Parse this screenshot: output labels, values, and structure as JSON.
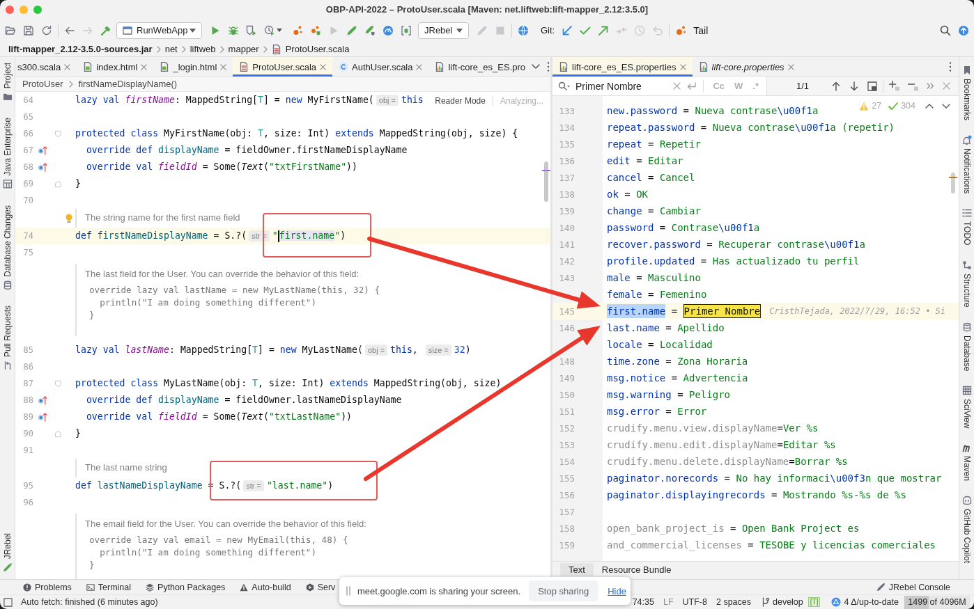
{
  "window": {
    "title": "OBP-API-2022 – ProtoUser.scala [Maven: net.liftweb:lift-mapper_2.12:3.5.0]"
  },
  "toolbar": {
    "buttons": [
      {
        "disabled": false
      },
      {
        "disabled": false
      },
      {
        "disabled": false
      },
      {
        "disabled": false
      },
      {
        "disabled": true
      },
      {
        "disabled": false
      },
      {
        "disabled": false
      },
      {
        "disabled": false
      },
      {
        "disabled": false
      },
      {
        "disabled": false
      },
      {
        "disabled": false
      },
      {
        "disabled": false
      },
      {
        "disabled": true
      },
      {
        "disabled": false
      },
      {
        "disabled": false
      },
      {
        "disabled": false
      },
      {
        "disabled": false
      },
      {
        "disabled": true
      },
      {
        "disabled": true
      },
      {
        "disabled": false
      },
      {
        "disabled": false
      },
      {
        "disabled": false
      },
      {
        "disabled": false
      },
      {
        "disabled": true
      },
      {
        "disabled": true
      },
      {
        "disabled": true
      },
      {
        "disabled": false
      },
      {
        "disabled": false
      },
      {
        "disabled": false
      }
    ],
    "run_configuration": "RunWebApp",
    "jrebel_menu": "JRebel",
    "git_label": "Git:",
    "tail_button": "Tail"
  },
  "navigation_bar": {
    "items": [
      "lift-mapper_2.12-3.5.0-sources.jar",
      "net",
      "liftweb",
      "mapper",
      "ProtoUser.scala"
    ]
  },
  "left_tool_strip": {
    "top": [
      {
        "label": "Project"
      },
      {
        "label": "Java Enterprise"
      },
      {
        "label": "Database Changes"
      },
      {
        "label": "Pull Requests"
      }
    ],
    "bottom": [
      {
        "label": "JRebel"
      }
    ]
  },
  "left_editor": {
    "tabs": [
      {
        "label": "s300.scala",
        "kind": "plain",
        "selected": false,
        "closable": true
      },
      {
        "label": "index.html",
        "kind": "html",
        "selected": false,
        "closable": true
      },
      {
        "label": "_login.html",
        "kind": "html",
        "selected": false,
        "closable": true
      },
      {
        "label": "ProtoUser.scala",
        "kind": "scala",
        "selected": true,
        "closable": true
      },
      {
        "label": "AuthUser.scala",
        "kind": "class",
        "selected": false,
        "closable": true
      },
      {
        "label": "lift-core_es_ES.pro",
        "kind": "properties",
        "selected": false,
        "closable": false
      }
    ],
    "breadcrumbs": [
      "ProtoUser",
      "firstNameDisplayName()"
    ],
    "reader_mode": "Reader Mode",
    "analysis_status": "Analyzing...",
    "lines": [
      {
        "kind": "code",
        "number": "64",
        "current": false,
        "tokens": [
          {
            "kind": "kw",
            "text": "lazy val "
          },
          {
            "kind": "field",
            "text": "firstName"
          },
          {
            "kind": "plain",
            "text": ": MappedString["
          },
          {
            "kind": "tparam",
            "text": "T"
          },
          {
            "kind": "plain",
            "text": "] = "
          },
          {
            "kind": "kw",
            "text": "new "
          },
          {
            "kind": "plain",
            "text": "MyFirstName("
          },
          {
            "kind": "hint",
            "text": "obj ="
          },
          {
            "kind": "kw",
            "text": "this"
          }
        ]
      },
      {
        "kind": "code",
        "number": "65",
        "current": false
      },
      {
        "kind": "code",
        "number": "66",
        "marker": {
          "kind": "fold-start"
        },
        "current": false,
        "tokens": [
          {
            "kind": "kw",
            "text": "protected class "
          },
          {
            "kind": "plain",
            "text": "MyFirstName(obj: "
          },
          {
            "kind": "tparam",
            "text": "T"
          },
          {
            "kind": "plain",
            "text": ", size: Int) "
          },
          {
            "kind": "kw",
            "text": "extends "
          },
          {
            "kind": "plain",
            "text": "MappedString(obj, size) {"
          }
        ]
      },
      {
        "kind": "code",
        "number": "67",
        "marker": {
          "kind": "override"
        },
        "current": false,
        "tokens": [
          {
            "kind": "kw",
            "text": "  override def "
          },
          {
            "kind": "decl",
            "text": "displayName"
          },
          {
            "kind": "plain",
            "text": " = fieldOwner.firstNameDisplayName"
          }
        ]
      },
      {
        "kind": "code",
        "number": "68",
        "marker": {
          "kind": "override"
        },
        "current": false,
        "tokens": [
          {
            "kind": "kw",
            "text": "  override val "
          },
          {
            "kind": "field",
            "text": "fieldId"
          },
          {
            "kind": "plain",
            "text": " = Some("
          },
          {
            "kind": "call",
            "text": "Text"
          },
          {
            "kind": "plain",
            "text": "("
          },
          {
            "kind": "str",
            "text": "\"txtFirstName\""
          },
          {
            "kind": "plain",
            "text": "))"
          }
        ]
      },
      {
        "kind": "code",
        "number": "69",
        "marker": {
          "kind": "fold-end"
        },
        "current": false,
        "tokens": [
          {
            "kind": "plain",
            "text": "}"
          }
        ]
      },
      {
        "kind": "code",
        "number": "70",
        "current": false
      },
      {
        "kind": "doc",
        "bulb": true,
        "text": "The string name for the first name field"
      },
      {
        "kind": "code",
        "number": "74",
        "current": true,
        "tokens": [
          {
            "kind": "kw",
            "text": "def "
          },
          {
            "kind": "decl",
            "text": "firstNameDisplayName"
          },
          {
            "kind": "plain",
            "text": " = S.?("
          },
          {
            "kind": "hint",
            "text": "str ="
          },
          {
            "kind": "str",
            "text": "\""
          },
          {
            "kind": "caret"
          },
          {
            "kind": "strmark",
            "text": "first.name"
          },
          {
            "kind": "str",
            "text": "\""
          },
          {
            "kind": "plain",
            "text": ")"
          }
        ]
      },
      {
        "kind": "code",
        "number": "75",
        "current": false
      },
      {
        "kind": "doc",
        "bulb": false,
        "text": "The last field for the User. You can override the behavior of this field:",
        "code": [
          "override lazy val lastName = new MyLastName(this, 32) {",
          "  println(\"I am doing something different\")",
          "}"
        ]
      },
      {
        "kind": "code",
        "number": "85",
        "current": false,
        "tokens": [
          {
            "kind": "kw",
            "text": "lazy val "
          },
          {
            "kind": "field",
            "text": "lastName"
          },
          {
            "kind": "plain",
            "text": ": MappedString["
          },
          {
            "kind": "tparam",
            "text": "T"
          },
          {
            "kind": "plain",
            "text": "] = "
          },
          {
            "kind": "kw",
            "text": "new "
          },
          {
            "kind": "plain",
            "text": "MyLastName("
          },
          {
            "kind": "hint",
            "text": "obj ="
          },
          {
            "kind": "kw",
            "text": "this"
          },
          {
            "kind": "plain",
            "text": ", "
          },
          {
            "kind": "hint",
            "text": "size ="
          },
          {
            "kind": "num",
            "text": "32"
          },
          {
            "kind": "plain",
            "text": ")"
          }
        ]
      },
      {
        "kind": "code",
        "number": "86",
        "current": false
      },
      {
        "kind": "code",
        "number": "87",
        "marker": {
          "kind": "fold-start"
        },
        "current": false,
        "tokens": [
          {
            "kind": "kw",
            "text": "protected class "
          },
          {
            "kind": "plain",
            "text": "MyLastName(obj: "
          },
          {
            "kind": "tparam",
            "text": "T"
          },
          {
            "kind": "plain",
            "text": ", size: Int) "
          },
          {
            "kind": "kw",
            "text": "extends "
          },
          {
            "kind": "plain",
            "text": "MappedString(obj, size)"
          }
        ]
      },
      {
        "kind": "code",
        "number": "88",
        "marker": {
          "kind": "override"
        },
        "current": false,
        "tokens": [
          {
            "kind": "kw",
            "text": "  override def "
          },
          {
            "kind": "decl",
            "text": "displayName"
          },
          {
            "kind": "plain",
            "text": " = fieldOwner.lastNameDisplayName"
          }
        ]
      },
      {
        "kind": "code",
        "number": "89",
        "marker": {
          "kind": "override"
        },
        "current": false,
        "tokens": [
          {
            "kind": "kw",
            "text": "  override val "
          },
          {
            "kind": "field",
            "text": "fieldId"
          },
          {
            "kind": "plain",
            "text": " = Some("
          },
          {
            "kind": "call",
            "text": "Text"
          },
          {
            "kind": "plain",
            "text": "("
          },
          {
            "kind": "str",
            "text": "\"txtLastName\""
          },
          {
            "kind": "plain",
            "text": "))"
          }
        ]
      },
      {
        "kind": "code",
        "number": "90",
        "marker": {
          "kind": "fold-end"
        },
        "current": false,
        "tokens": [
          {
            "kind": "plain",
            "text": "}"
          }
        ]
      },
      {
        "kind": "code",
        "number": "91",
        "current": false
      },
      {
        "kind": "doc",
        "bulb": false,
        "text": "The last name string"
      },
      {
        "kind": "code",
        "number": "95",
        "current": false,
        "tokens": [
          {
            "kind": "kw",
            "text": "def "
          },
          {
            "kind": "decl",
            "text": "lastNameDisplayName"
          },
          {
            "kind": "plain",
            "text": " = S.?("
          },
          {
            "kind": "hint",
            "text": "str ="
          },
          {
            "kind": "str",
            "text": "\"last.name\""
          },
          {
            "kind": "plain",
            "text": ")"
          }
        ]
      },
      {
        "kind": "code",
        "number": "96",
        "current": false
      },
      {
        "kind": "doc",
        "bulb": false,
        "text": "The email field for the User. You can override the behavior of this field:",
        "code": [
          "override lazy val email = new MyEmail(this, 48) {",
          "  println(\"I am doing something different\")",
          "}"
        ]
      }
    ]
  },
  "right_editor": {
    "tabs": [
      {
        "label": "lift-core_es_ES.properties",
        "kind": "properties",
        "selected": true,
        "preview": false,
        "closable": true
      },
      {
        "label": "lift-core.properties",
        "kind": "properties",
        "selected": false,
        "preview": true,
        "closable": true
      }
    ],
    "search": {
      "value": "Primer Nombre",
      "options": [
        {
          "label": "Cc",
          "selected": false
        },
        {
          "label": "W",
          "selected": false
        },
        {
          "label": ".*",
          "selected": false
        }
      ],
      "match_count": "1/1"
    },
    "inspections": {
      "warnings": "27",
      "passed": "304"
    },
    "lines": [
      {
        "number": "133",
        "current": false,
        "tokens": [
          {
            "kind": "key",
            "text": "new.password"
          },
          {
            "kind": "plain",
            "text": " = "
          },
          {
            "kind": "val",
            "text": "Nueva contrase"
          },
          {
            "kind": "esc",
            "text": "\\u00f1"
          },
          {
            "kind": "val",
            "text": "a"
          }
        ]
      },
      {
        "number": "134",
        "current": false,
        "tokens": [
          {
            "kind": "key",
            "text": "repeat.password"
          },
          {
            "kind": "plain",
            "text": " = "
          },
          {
            "kind": "val",
            "text": "Nueva contrase"
          },
          {
            "kind": "esc",
            "text": "\\u00f1"
          },
          {
            "kind": "val",
            "text": "a (repetir)"
          }
        ]
      },
      {
        "number": "135",
        "current": false,
        "tokens": [
          {
            "kind": "key",
            "text": "repeat"
          },
          {
            "kind": "plain",
            "text": " = "
          },
          {
            "kind": "val",
            "text": "Repetir"
          }
        ]
      },
      {
        "number": "136",
        "current": false,
        "tokens": [
          {
            "kind": "key",
            "text": "edit"
          },
          {
            "kind": "plain",
            "text": " = "
          },
          {
            "kind": "val",
            "text": "Editar"
          }
        ]
      },
      {
        "number": "137",
        "current": false,
        "tokens": [
          {
            "kind": "key",
            "text": "cancel"
          },
          {
            "kind": "plain",
            "text": " = "
          },
          {
            "kind": "val",
            "text": "Cancel"
          }
        ]
      },
      {
        "number": "138",
        "current": false,
        "tokens": [
          {
            "kind": "key",
            "text": "ok"
          },
          {
            "kind": "plain",
            "text": " = "
          },
          {
            "kind": "val",
            "text": "OK"
          }
        ]
      },
      {
        "number": "139",
        "current": false,
        "tokens": [
          {
            "kind": "key",
            "text": "change"
          },
          {
            "kind": "plain",
            "text": " = "
          },
          {
            "kind": "val",
            "text": "Cambiar"
          }
        ]
      },
      {
        "number": "140",
        "current": false,
        "tokens": [
          {
            "kind": "key",
            "text": "password"
          },
          {
            "kind": "plain",
            "text": " = "
          },
          {
            "kind": "val",
            "text": "Contrase"
          },
          {
            "kind": "esc",
            "text": "\\u00f1"
          },
          {
            "kind": "val",
            "text": "a"
          }
        ]
      },
      {
        "number": "141",
        "current": false,
        "tokens": [
          {
            "kind": "key",
            "text": "recover.password"
          },
          {
            "kind": "plain",
            "text": " = "
          },
          {
            "kind": "val",
            "text": "Recuperar contrase"
          },
          {
            "kind": "esc",
            "text": "\\u00f1"
          },
          {
            "kind": "val",
            "text": "a"
          }
        ]
      },
      {
        "number": "142",
        "current": false,
        "tokens": [
          {
            "kind": "key",
            "text": "profile.updated"
          },
          {
            "kind": "plain",
            "text": " = "
          },
          {
            "kind": "val",
            "text": "Has actualizado tu perfil"
          }
        ]
      },
      {
        "number": "143",
        "current": false,
        "tokens": [
          {
            "kind": "key",
            "text": "male"
          },
          {
            "kind": "plain",
            "text": " = "
          },
          {
            "kind": "val",
            "text": "Masculino"
          }
        ]
      },
      {
        "current": false,
        "tokens": [
          {
            "kind": "key",
            "text": "female"
          },
          {
            "kind": "plain",
            "text": " = "
          },
          {
            "kind": "val",
            "text": "Femenino"
          }
        ]
      },
      {
        "number": "145",
        "current": true,
        "tokens": [
          {
            "kind": "selection",
            "text": "first.name"
          },
          {
            "kind": "plain",
            "text": " = "
          },
          {
            "kind": "match",
            "text": "Primer Nombre"
          },
          {
            "kind": "blame",
            "text": "CristhTejada, 2022/7/29, 16:52 • Si"
          }
        ]
      },
      {
        "number": "146",
        "current": false,
        "tokens": [
          {
            "kind": "key",
            "text": "last.name"
          },
          {
            "kind": "plain",
            "text": " = "
          },
          {
            "kind": "val",
            "text": "Apellido"
          }
        ]
      },
      {
        "current": false,
        "tokens": [
          {
            "kind": "key",
            "text": "locale"
          },
          {
            "kind": "plain",
            "text": " = "
          },
          {
            "kind": "val",
            "text": "Localidad"
          }
        ]
      },
      {
        "number": "148",
        "current": false,
        "tokens": [
          {
            "kind": "key",
            "text": "time.zone"
          },
          {
            "kind": "plain",
            "text": " = "
          },
          {
            "kind": "val",
            "text": "Zona Horaria"
          }
        ]
      },
      {
        "number": "149",
        "current": false,
        "tokens": [
          {
            "kind": "key",
            "text": "msg.notice"
          },
          {
            "kind": "plain",
            "text": " = "
          },
          {
            "kind": "val",
            "text": "Advertencia"
          }
        ]
      },
      {
        "number": "150",
        "current": false,
        "tokens": [
          {
            "kind": "key",
            "text": "msg.warning"
          },
          {
            "kind": "plain",
            "text": " = "
          },
          {
            "kind": "val",
            "text": "Peligro"
          }
        ]
      },
      {
        "number": "151",
        "current": false,
        "tokens": [
          {
            "kind": "key",
            "text": "msg.error"
          },
          {
            "kind": "plain",
            "text": " = "
          },
          {
            "kind": "val",
            "text": "Error"
          }
        ]
      },
      {
        "number": "152",
        "current": false,
        "tokens": [
          {
            "kind": "unused",
            "text": "crudify.menu.view.displayName"
          },
          {
            "kind": "plain",
            "text": "="
          },
          {
            "kind": "val",
            "text": "Ver %s"
          }
        ]
      },
      {
        "number": "153",
        "current": false,
        "tokens": [
          {
            "kind": "unused",
            "text": "crudify.menu.edit.displayName"
          },
          {
            "kind": "plain",
            "text": "="
          },
          {
            "kind": "val",
            "text": "Editar %s"
          }
        ]
      },
      {
        "number": "154",
        "current": false,
        "tokens": [
          {
            "kind": "unused",
            "text": "crudify.menu.delete.displayName"
          },
          {
            "kind": "plain",
            "text": "="
          },
          {
            "kind": "val",
            "text": "Borrar %s"
          }
        ]
      },
      {
        "number": "155",
        "current": false,
        "tokens": [
          {
            "kind": "key",
            "text": "paginator.norecords"
          },
          {
            "kind": "plain",
            "text": " = "
          },
          {
            "kind": "val",
            "text": "No hay informaci"
          },
          {
            "kind": "esc",
            "text": "\\u00f3"
          },
          {
            "kind": "val",
            "text": "n que mostrar"
          }
        ]
      },
      {
        "number": "156",
        "current": false,
        "tokens": [
          {
            "kind": "key",
            "text": "paginator.displayingrecords"
          },
          {
            "kind": "plain",
            "text": " = "
          },
          {
            "kind": "val",
            "text": "Mostrando %s-%s de %s"
          }
        ]
      },
      {
        "number": "157",
        "current": false
      },
      {
        "number": "158",
        "current": false,
        "tokens": [
          {
            "kind": "unused",
            "text": "open_bank_project_is"
          },
          {
            "kind": "plain",
            "text": " = "
          },
          {
            "kind": "val",
            "text": "Open Bank Project es"
          }
        ]
      },
      {
        "number": "159",
        "current": false,
        "tokens": [
          {
            "kind": "unused",
            "text": "and_commercial_licenses"
          },
          {
            "kind": "plain",
            "text": " = "
          },
          {
            "kind": "val",
            "text": "TESOBE y licencias comerciales"
          }
        ]
      }
    ],
    "bottom_tabs": [
      {
        "label": "Text",
        "selected": true
      },
      {
        "label": "Resource Bundle",
        "selected": false
      }
    ]
  },
  "right_tool_strip": {
    "items": [
      {
        "label": "Bookmarks"
      },
      {
        "label": "Notifications"
      },
      {
        "label": "TODO"
      },
      {
        "label": "Structure"
      },
      {
        "label": "Database"
      },
      {
        "label": "SciView"
      },
      {
        "label": "Maven"
      },
      {
        "label": "GitHub Copilot"
      }
    ]
  },
  "tool_window_bar": {
    "left": [
      {
        "label": "Problems"
      },
      {
        "label": "Terminal"
      },
      {
        "label": "Python Packages"
      },
      {
        "label": "Auto-build"
      },
      {
        "label": "Serv"
      }
    ],
    "right": [
      {
        "label": "JRebel Console"
      }
    ]
  },
  "status_bar": {
    "message": "Auto fetch: finished (6 minutes ago)",
    "caret_position": "74:35",
    "line_separator": "LF",
    "encoding": "UTF-8",
    "indentation": "2 spaces",
    "branch": "develop",
    "tag": "[T]",
    "vcs_status": "4 Δ/up-to-date",
    "memory": {
      "text": "1499 of 4096M",
      "level": 0.37
    }
  },
  "screen_share_banner": {
    "message": "meet.google.com is sharing your screen.",
    "stop_button": "Stop sharing",
    "hide_link": "Hide"
  },
  "annotations": [
    {
      "kind": "frame"
    },
    {
      "kind": "arrow"
    },
    {
      "kind": "frame"
    },
    {
      "kind": "arrow"
    }
  ]
}
